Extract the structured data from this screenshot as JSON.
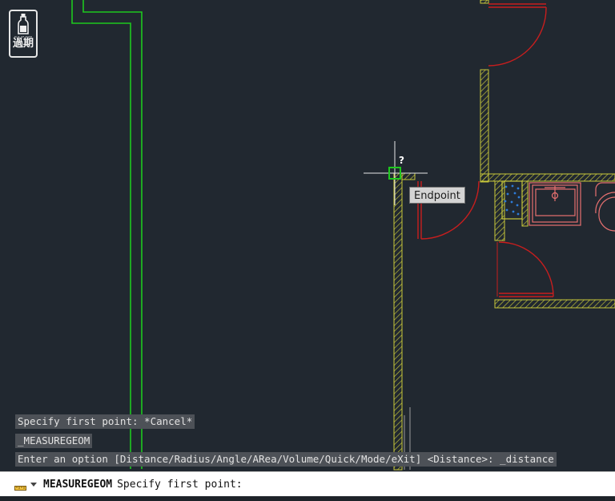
{
  "logo": {
    "small_text": "OUT OF DATE",
    "big_text": "過期"
  },
  "tooltip": {
    "label": "Endpoint"
  },
  "cursor": {
    "badge": "?"
  },
  "history": [
    "Specify first point: *Cancel*",
    "_MEASUREGEOM",
    "Enter an option [Distance/Radius/Angle/ARea/Volume/Quick/Mode/eXit] <Distance>: _distance"
  ],
  "command": {
    "name": "MEASUREGEOM",
    "prompt": "Specify first point:"
  },
  "colors": {
    "background": "#212830",
    "wall_yellow": "#c9c93a",
    "door_red": "#c81e1e",
    "fixture_pink": "#e87070",
    "green_line": "#1ec81e",
    "snap_green": "#1ec81e"
  },
  "icons": [
    "measure-ruler-icon",
    "dropdown-arrow-icon",
    "bottle-icon",
    "crosshair-icon"
  ]
}
